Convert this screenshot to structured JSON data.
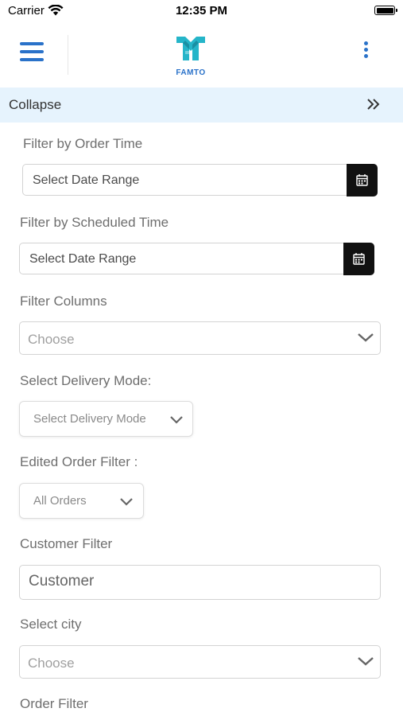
{
  "status_bar": {
    "carrier": "Carrier",
    "time": "12:35 PM"
  },
  "header": {
    "logo_text": "FAMTO",
    "brand_color": "#2a72c9"
  },
  "collapse": {
    "label": "Collapse"
  },
  "filters": {
    "order_time": {
      "label": "Filter by Order Time",
      "placeholder": "Select Date Range"
    },
    "scheduled_time": {
      "label": "Filter by Scheduled Time",
      "placeholder": "Select Date Range"
    },
    "columns": {
      "label": "Filter Columns",
      "value": "Choose"
    },
    "delivery_mode": {
      "label": "Select Delivery Mode:",
      "value": "Select Delivery Mode"
    },
    "edited_order": {
      "label": "Edited Order Filter :",
      "value": "All Orders"
    },
    "customer": {
      "label": "Customer Filter",
      "placeholder": "Customer"
    },
    "city": {
      "label": "Select city",
      "value": "Choose"
    },
    "order_filter": {
      "label": "Order Filter"
    }
  }
}
